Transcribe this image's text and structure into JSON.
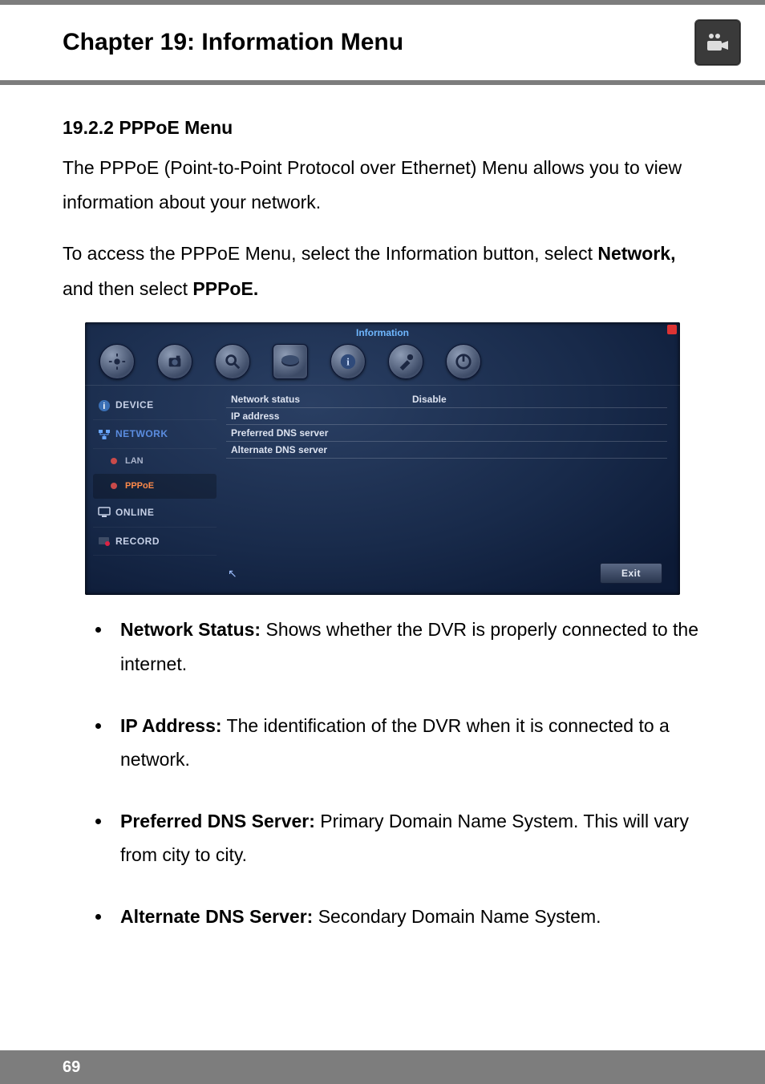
{
  "header": {
    "chapter_title": "Chapter 19: Information Menu"
  },
  "section": {
    "heading": "19.2.2 PPPoE Menu",
    "intro_1": "The PPPoE (Point-to-Point Protocol over Ethernet) Menu allows you to view information about your network.",
    "intro_2a": "To access the PPPoE Menu, select the Information button, select ",
    "intro_2_bold1": "Network,",
    "intro_2b": " and then select ",
    "intro_2_bold2": "PPPoE."
  },
  "screenshot": {
    "window_title": "Information",
    "sidebar": {
      "items": [
        {
          "label": "DEVICE",
          "name": "sidebar-item-device"
        },
        {
          "label": "NETWORK",
          "name": "sidebar-item-network",
          "selected": true
        },
        {
          "label": "ONLINE",
          "name": "sidebar-item-online"
        },
        {
          "label": "RECORD",
          "name": "sidebar-item-record"
        }
      ],
      "sub": {
        "lan": "LAN",
        "pppoe": "PPPoE"
      }
    },
    "table": {
      "rows": [
        {
          "label": "Network status",
          "value": "Disable"
        },
        {
          "label": "IP address",
          "value": ""
        },
        {
          "label": "Preferred DNS server",
          "value": ""
        },
        {
          "label": "Alternate DNS server",
          "value": ""
        }
      ]
    },
    "exit_label": "Exit"
  },
  "bullets": [
    {
      "term": "Network Status:",
      "text": " Shows whether the DVR is properly connected to the internet."
    },
    {
      "term": "IP Address:",
      "text": " The identification of the DVR when it is connected to a network."
    },
    {
      "term": "Preferred DNS Server:",
      "text": " Primary Domain Name System. This will vary from city to city."
    },
    {
      "term": "Alternate DNS Server:",
      "text": " Secondary Domain Name System."
    }
  ],
  "footer": {
    "page_number": "69"
  }
}
